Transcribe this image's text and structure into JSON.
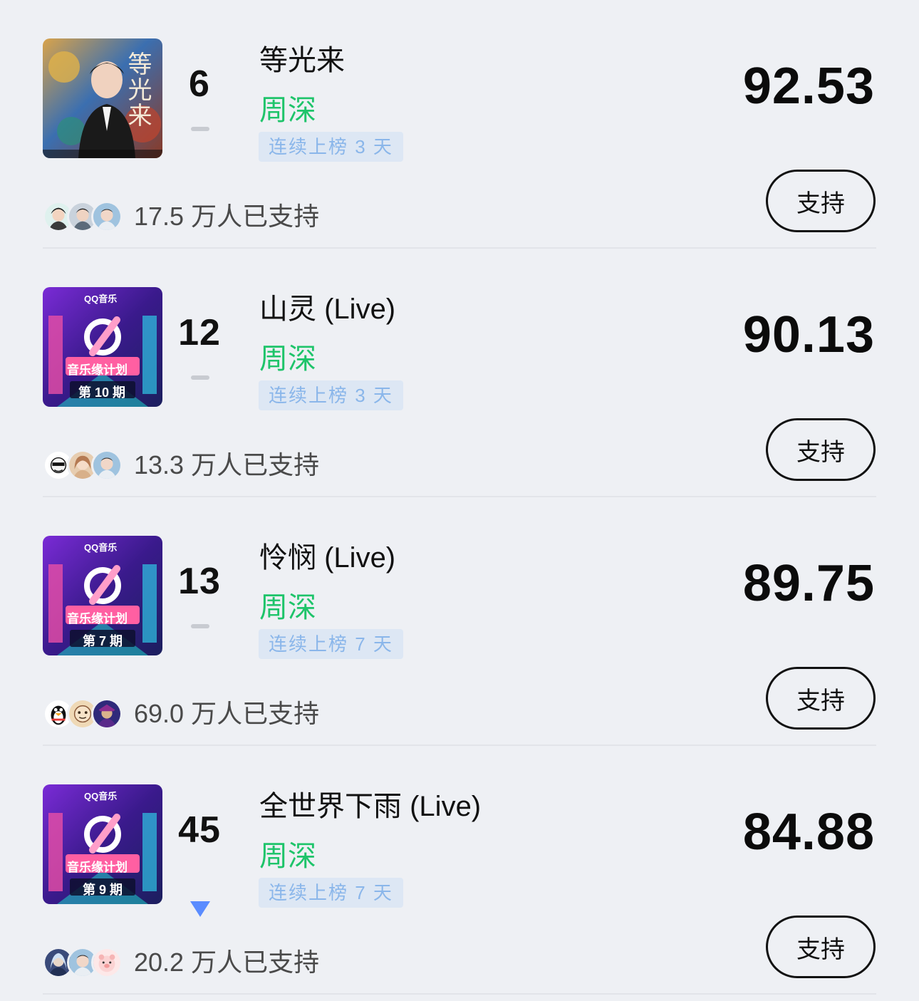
{
  "colors": {
    "artist": "#1ec46a",
    "streak_text": "#8ab6ea",
    "streak_bg": "#dde7f4",
    "trend_down": "#5a8cff",
    "background": "#eef0f4"
  },
  "songs": [
    {
      "rank": "6",
      "trend": "flat",
      "title": "等光来",
      "artist": "周深",
      "streak": "连续上榜 3 天",
      "score": "92.53",
      "supporters": "17.5 万人已支持",
      "support_label": "支持",
      "cover": {
        "icon": "album-cover-portrait",
        "text": "等光来"
      }
    },
    {
      "rank": "12",
      "trend": "flat",
      "title": "山灵 (Live)",
      "artist": "周深",
      "streak": "连续上榜 3 天",
      "score": "90.13",
      "supporters": "13.3 万人已支持",
      "support_label": "支持",
      "cover": {
        "icon": "album-cover-qq-music",
        "brand": "QQ音乐",
        "show": "音乐缘计划",
        "episode": "第 10 期"
      }
    },
    {
      "rank": "13",
      "trend": "flat",
      "title": "怜悯 (Live)",
      "artist": "周深",
      "streak": "连续上榜 7 天",
      "score": "89.75",
      "supporters": "69.0 万人已支持",
      "support_label": "支持",
      "cover": {
        "icon": "album-cover-qq-music",
        "brand": "QQ音乐",
        "show": "音乐缘计划",
        "episode": "第 7 期"
      }
    },
    {
      "rank": "45",
      "trend": "down",
      "title": "全世界下雨 (Live)",
      "artist": "周深",
      "streak": "连续上榜 7 天",
      "score": "84.88",
      "supporters": "20.2 万人已支持",
      "support_label": "支持",
      "cover": {
        "icon": "album-cover-qq-music",
        "brand": "QQ音乐",
        "show": "音乐缘计划",
        "episode": "第 9 期"
      }
    }
  ]
}
